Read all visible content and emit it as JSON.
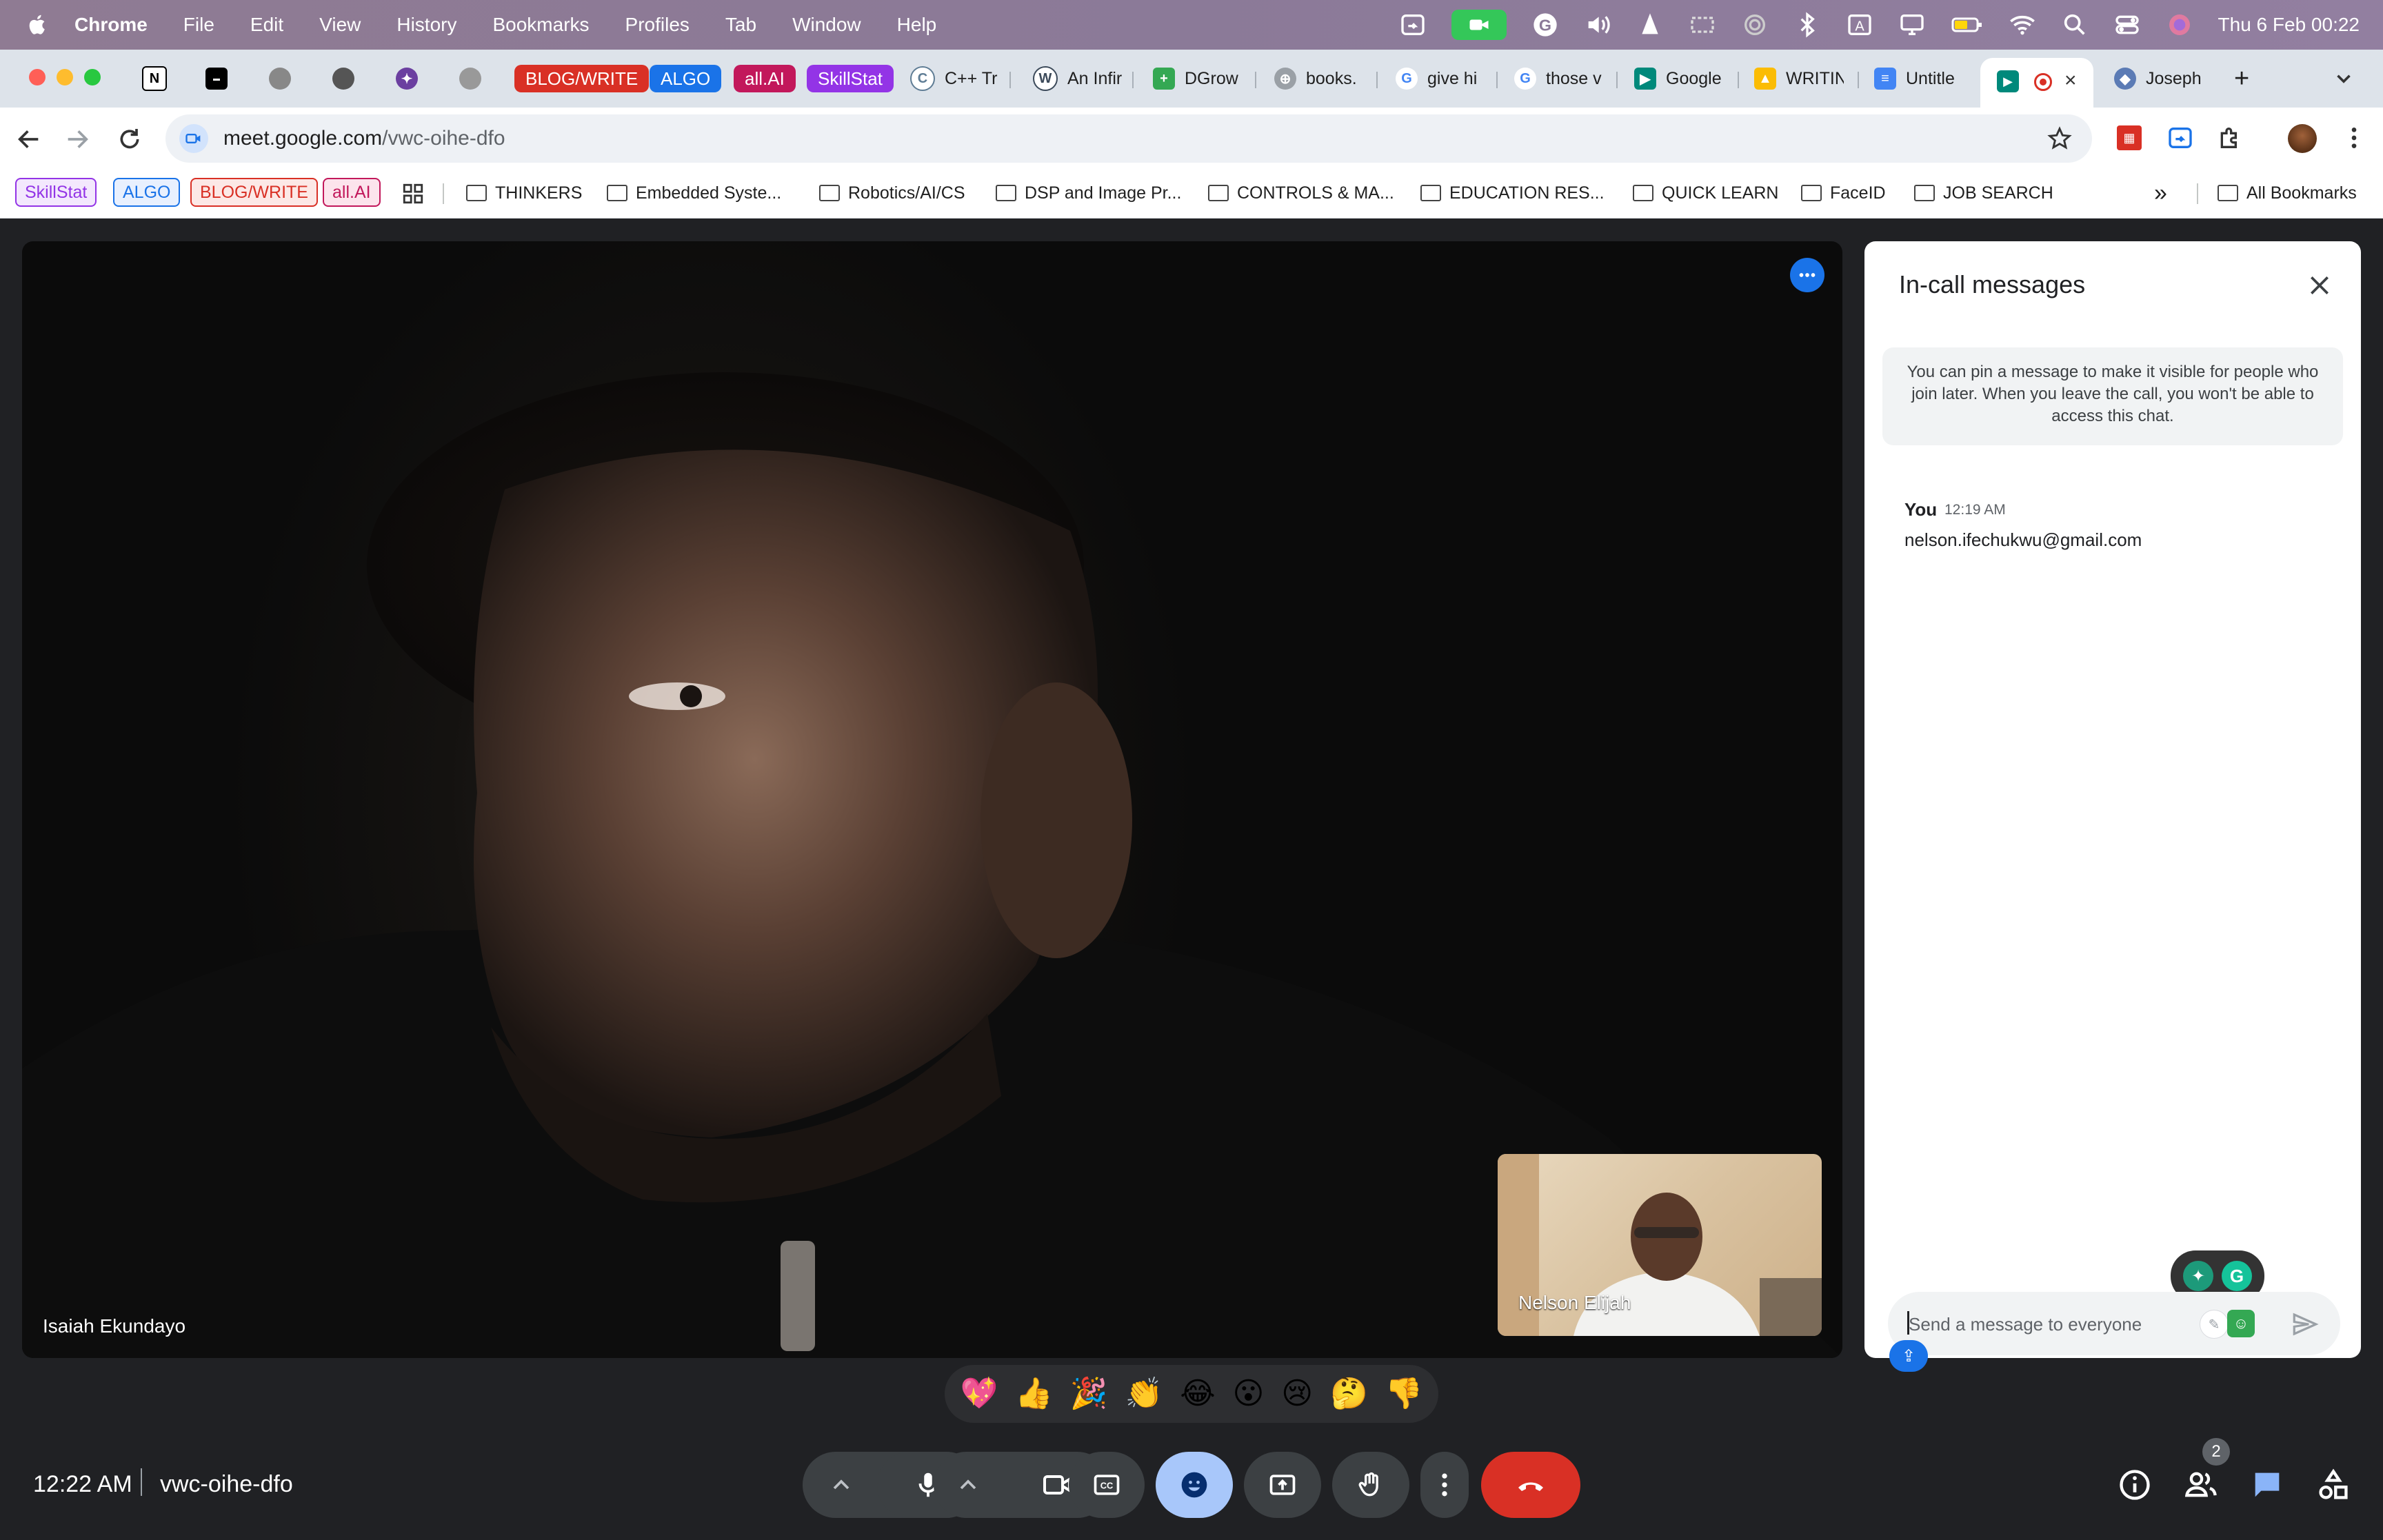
{
  "menubar": {
    "app_name": "Chrome",
    "items": [
      "File",
      "Edit",
      "View",
      "History",
      "Bookmarks",
      "Profiles",
      "Tab",
      "Window",
      "Help"
    ],
    "clock": "Thu 6 Feb  00:22"
  },
  "tabs": {
    "pill_tabs": [
      "BLOG/WRITE",
      "ALGO",
      "all.AI",
      "SkillStat"
    ],
    "titled_tabs": [
      "C++ Tr",
      "An Infir",
      "DGrow",
      "books.",
      "give hi",
      "those v",
      "Google",
      "WRITIN",
      "Untitle",
      "Joseph"
    ],
    "new_tab": "+"
  },
  "address_bar": {
    "host": "meet.google.com",
    "path": "/vwc-oihe-dfo"
  },
  "bookmarks": {
    "pills": [
      "SkillStat",
      "ALGO",
      "BLOG/WRITE",
      "all.AI"
    ],
    "folders": [
      "THINKERS",
      "Embedded Syste...",
      "Robotics/AI/CS",
      "DSP and Image Pr...",
      "CONTROLS & MA...",
      "EDUCATION RES...",
      "QUICK LEARN",
      "FaceID",
      "JOB SEARCH"
    ],
    "overflow": "»",
    "all_bookmarks": "All Bookmarks"
  },
  "meeting": {
    "speaker_name": "Isaiah Ekundayo",
    "self_name": "Nelson Elijah",
    "time": "12:22 AM",
    "code": "vwc-oihe-dfo",
    "people_count": "2"
  },
  "chat": {
    "title": "In-call messages",
    "note": "You can pin a message to make it visible for people who join later. When you leave the call, you won't be able to access this chat.",
    "messages": [
      {
        "sender": "You",
        "time": "12:19 AM",
        "text": "nelson.ifechukwu@gmail.com"
      }
    ],
    "input_placeholder": "Send a message to everyone"
  },
  "reactions": [
    "💖",
    "👍",
    "🎉",
    "👏",
    "😂",
    "😮",
    "😢",
    "🤔",
    "👎"
  ],
  "colors": {
    "meet_blue": "#1a73e8",
    "end_call_red": "#d93025",
    "control_grey": "#3c4043",
    "active_control": "#a8c7fa"
  }
}
